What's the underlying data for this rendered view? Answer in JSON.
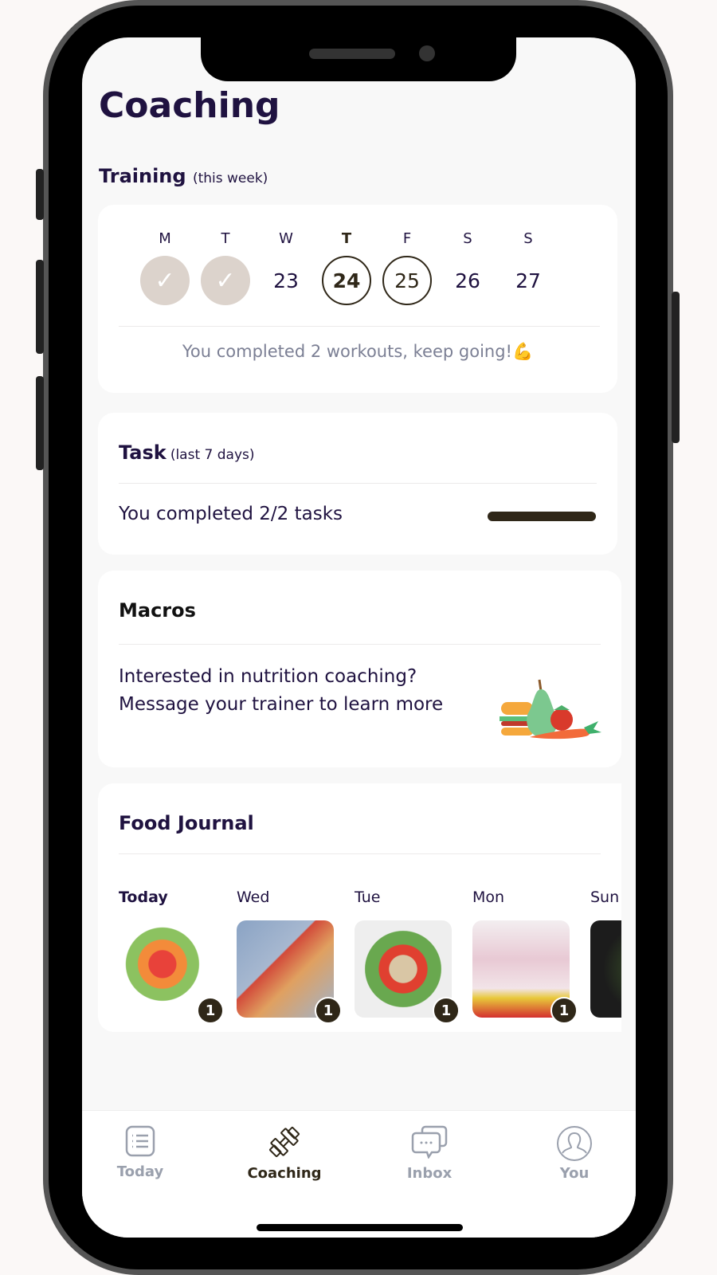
{
  "page": {
    "title": "Coaching"
  },
  "training": {
    "label": "Training",
    "sublabel": "(this week)",
    "days": [
      {
        "letter": "M",
        "date": "",
        "state": "done"
      },
      {
        "letter": "T",
        "date": "",
        "state": "done"
      },
      {
        "letter": "W",
        "date": "23",
        "state": "none"
      },
      {
        "letter": "T",
        "date": "24",
        "state": "today"
      },
      {
        "letter": "F",
        "date": "25",
        "state": "scheduled"
      },
      {
        "letter": "S",
        "date": "26",
        "state": "none"
      },
      {
        "letter": "S",
        "date": "27",
        "state": "none"
      }
    ],
    "summary": "You completed 2 workouts, keep going!💪"
  },
  "task": {
    "label": "Task",
    "sublabel": "(last 7 days)",
    "summary": "You completed 2/2 tasks",
    "progress_percent": 100
  },
  "macros": {
    "label": "Macros",
    "line1": "Interested in nutrition coaching?",
    "line2": "Message your trainer to learn more",
    "icon": "food-illustration"
  },
  "food_journal": {
    "label": "Food Journal",
    "entries": [
      {
        "day": "Today",
        "count": "1"
      },
      {
        "day": "Wed",
        "count": "1"
      },
      {
        "day": "Tue",
        "count": "1"
      },
      {
        "day": "Mon",
        "count": "1"
      },
      {
        "day": "Sun",
        "count": ""
      }
    ]
  },
  "nav": [
    {
      "label": "Today",
      "icon": "list-icon"
    },
    {
      "label": "Coaching",
      "icon": "dumbbell-icon",
      "active": true
    },
    {
      "label": "Inbox",
      "icon": "chat-icon"
    },
    {
      "label": "You",
      "icon": "user-icon"
    }
  ],
  "colors": {
    "title": "#1f1240",
    "accent": "#2f2718",
    "done": "#dcd3cc"
  }
}
